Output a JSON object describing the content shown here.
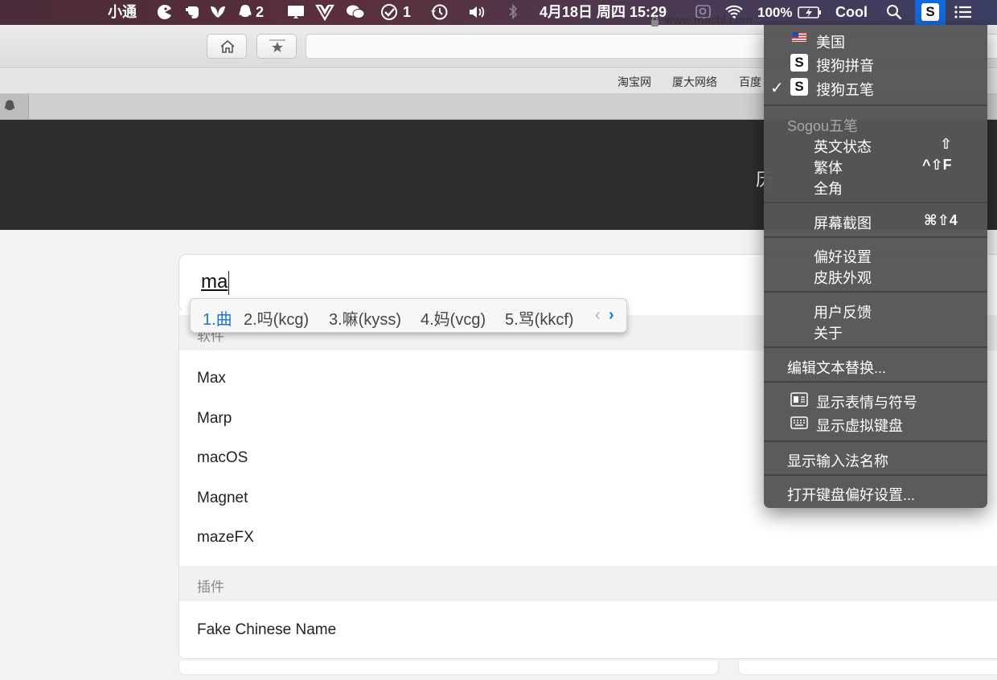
{
  "menubar": {
    "app_name": "小通",
    "qq_badge": "2",
    "todo_badge": "1",
    "datetime": "4月18日 周四 15:29",
    "battery": "100%",
    "user": "Cool"
  },
  "browser": {
    "url": "www.macbl.com",
    "bookmarks": [
      "淘宝网",
      "厦大网络",
      "百度"
    ]
  },
  "page": {
    "banner_fragment": "历",
    "search_value": "ma",
    "sections": [
      {
        "title": "软件",
        "items": [
          "Max",
          "Marp",
          "macOS",
          "Magnet",
          "mazeFX"
        ]
      },
      {
        "title": "插件",
        "items": [
          "Fake Chinese Name"
        ]
      }
    ]
  },
  "ime": {
    "candidates": [
      "1.曲",
      "2.吗(kcg)",
      "3.嘛(kyss)",
      "4.妈(vcg)",
      "5.骂(kkcf)"
    ],
    "prev": "‹",
    "next": "›"
  },
  "input_menu": {
    "sources": [
      {
        "label": "美国",
        "icon": "us-flag-icon",
        "checked": false
      },
      {
        "label": "搜狗拼音",
        "icon": "sogou-icon",
        "checked": false
      },
      {
        "label": "搜狗五笔",
        "icon": "sogou-icon",
        "checked": true
      }
    ],
    "check_mark": "✓",
    "group_title": "Sogou五笔",
    "group_items": [
      {
        "label": "英文状态",
        "shortcut": "⇧"
      },
      {
        "label": "繁体",
        "shortcut": "^⇧F"
      },
      {
        "label": "全角",
        "shortcut": ""
      }
    ],
    "screenshot": {
      "label": "屏幕截图",
      "shortcut": "⌘⇧4"
    },
    "prefs": [
      "偏好设置",
      "皮肤外观"
    ],
    "feedback": [
      "用户反馈",
      "关于"
    ],
    "edit_replace": "编辑文本替换...",
    "show_emoji": "显示表情与符号",
    "show_keyboard": "显示虚拟键盘",
    "show_name": "显示输入法名称",
    "open_prefs": "打开键盘偏好设置..."
  }
}
